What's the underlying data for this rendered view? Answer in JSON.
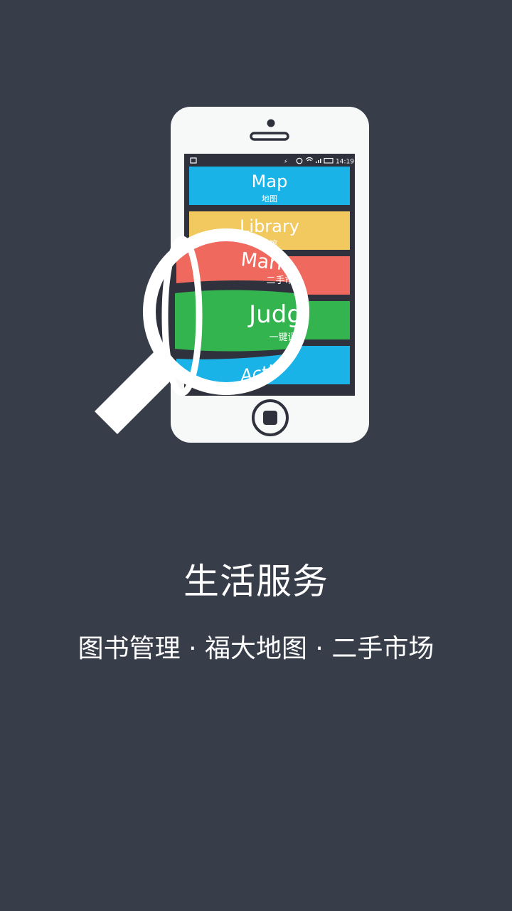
{
  "phone": {
    "status_time": "14:19",
    "tiles": [
      {
        "label": "Map",
        "sublabel": "地图",
        "color": "#1ab3e8"
      },
      {
        "label": "Library",
        "sublabel": "书馆",
        "color": "#f2c95f"
      },
      {
        "label": "Market",
        "sublabel": "二手市",
        "color": "#f0695e"
      },
      {
        "label": "Judge",
        "sublabel": "一键评",
        "color": "#33b44f"
      },
      {
        "label": "Activity",
        "sublabel": "",
        "color": "#1ab3e8"
      }
    ]
  },
  "title": "生活服务",
  "subtitle": "图书管理 · 福大地图 · 二手市场",
  "colors": {
    "background": "#383d4a",
    "phone_body": "#f7f8f8",
    "phone_screen": "#2f323c"
  }
}
